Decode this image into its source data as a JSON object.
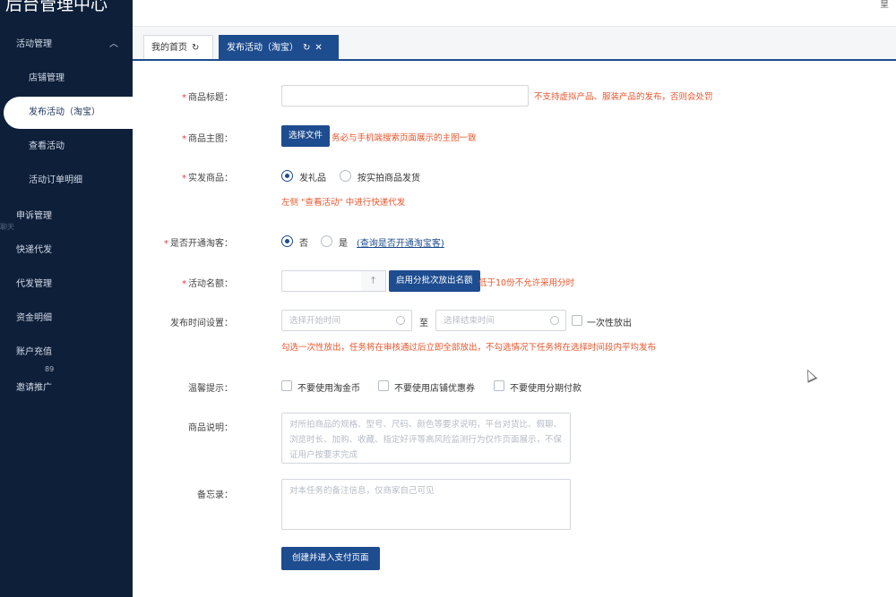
{
  "app": {
    "title": "后台管理中心",
    "top_mark": "皇"
  },
  "sidebar": {
    "group_activity": "活动管理",
    "items": [
      {
        "label": "店铺管理"
      },
      {
        "label": "发布活动（淘宝）"
      },
      {
        "label": "查看活动"
      },
      {
        "label": "活动订单明细"
      }
    ],
    "groups": [
      {
        "label": "申诉管理"
      },
      {
        "label": "快递代发"
      },
      {
        "label": "代发管理"
      },
      {
        "label": "资金明细"
      },
      {
        "label": "账户充值"
      },
      {
        "label": "邀请推广"
      }
    ],
    "badge": "89",
    "ghost_text": "聊天"
  },
  "tabs": [
    {
      "label": "我的首页"
    },
    {
      "label": "发布活动（淘宝）"
    }
  ],
  "form": {
    "title_label": "商品标题：",
    "title_hint": "不支持虚拟产品、服装产品的发布，否则会处罚",
    "image_label": "商品主图：",
    "image_button": "选择文件",
    "image_hint": "务必与手机端搜索页面展示的主图一致",
    "ship_label": "实发商品：",
    "ship_opt1": "发礼品",
    "ship_opt2": "按实拍商品发货",
    "ship_hint": "左侧 \"查看活动\" 中进行快递代发",
    "taoke_label": "是否开通淘客：",
    "taoke_no": "否",
    "taoke_yes": "是",
    "taoke_link": "(查询是否开通淘宝客)",
    "quota_label": "活动名额：",
    "quota_button": "启用分批次放出名额",
    "quota_hint": "低于10份不允许采用分时",
    "time_label": "发布时间设置：",
    "time_start_placeholder": "选择开始时间",
    "time_to": "至",
    "time_end_placeholder": "选择结束时间",
    "time_once": "一次性放出",
    "time_hint": "勾选一次性放出，任务将在审核通过后立即全部放出，不勾选情况下任务将在选择时间段内平均发布",
    "tips_label": "温馨提示：",
    "tips_opt1": "不要使用淘金币",
    "tips_opt2": "不要使用店铺优惠券",
    "tips_opt3": "不要使用分期付款",
    "desc_label": "商品说明：",
    "desc_placeholder": "对所拍商品的规格、型号、尺码、颜色等要求说明，平台对货比、假聊、浏览时长、加购、收藏、指定好评等高风险监测行为仅作页面展示，不保证用户按要求完成",
    "memo_label": "备忘录：",
    "memo_placeholder": "对本任务的备注信息，仅商家自己可见",
    "submit": "创建并进入支付页面"
  }
}
